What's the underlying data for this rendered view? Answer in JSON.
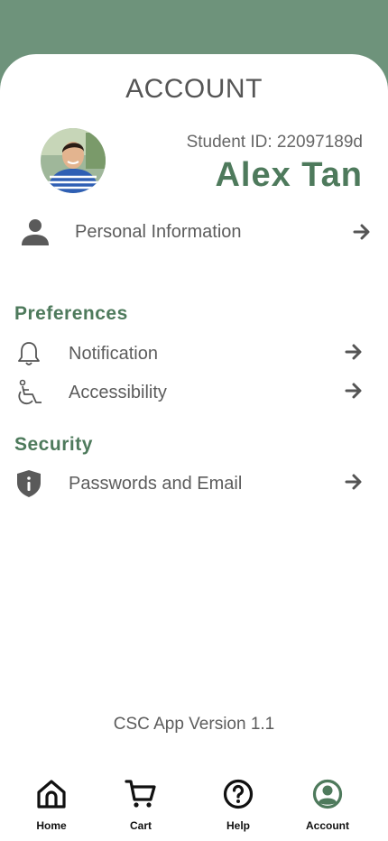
{
  "header": {
    "title": "ACCOUNT"
  },
  "profile": {
    "student_id": "Student ID: 22097189d",
    "name": "Alex Tan",
    "avatar_icon": "user-avatar-photo"
  },
  "personal": {
    "label": "Personal Information",
    "icon": "person-icon"
  },
  "preferences": {
    "heading": "Preferences",
    "items": [
      {
        "label": "Notification",
        "icon": "bell-icon"
      },
      {
        "label": "Accessibility",
        "icon": "wheelchair-icon"
      }
    ]
  },
  "security": {
    "heading": "Security",
    "items": [
      {
        "label": "Passwords and Email",
        "icon": "shield-info-icon"
      }
    ]
  },
  "footer": {
    "version": "CSC App Version 1.1"
  },
  "nav": {
    "items": [
      {
        "label": "Home",
        "icon": "home-icon"
      },
      {
        "label": "Cart",
        "icon": "cart-icon"
      },
      {
        "label": "Help",
        "icon": "help-icon"
      },
      {
        "label": "Account",
        "icon": "account-icon",
        "active": true
      }
    ]
  },
  "colors": {
    "header_bg": "#6e937b",
    "accent": "#4e7a5c",
    "text": "#5c5c5c",
    "active_nav": "#4e7a5c"
  }
}
